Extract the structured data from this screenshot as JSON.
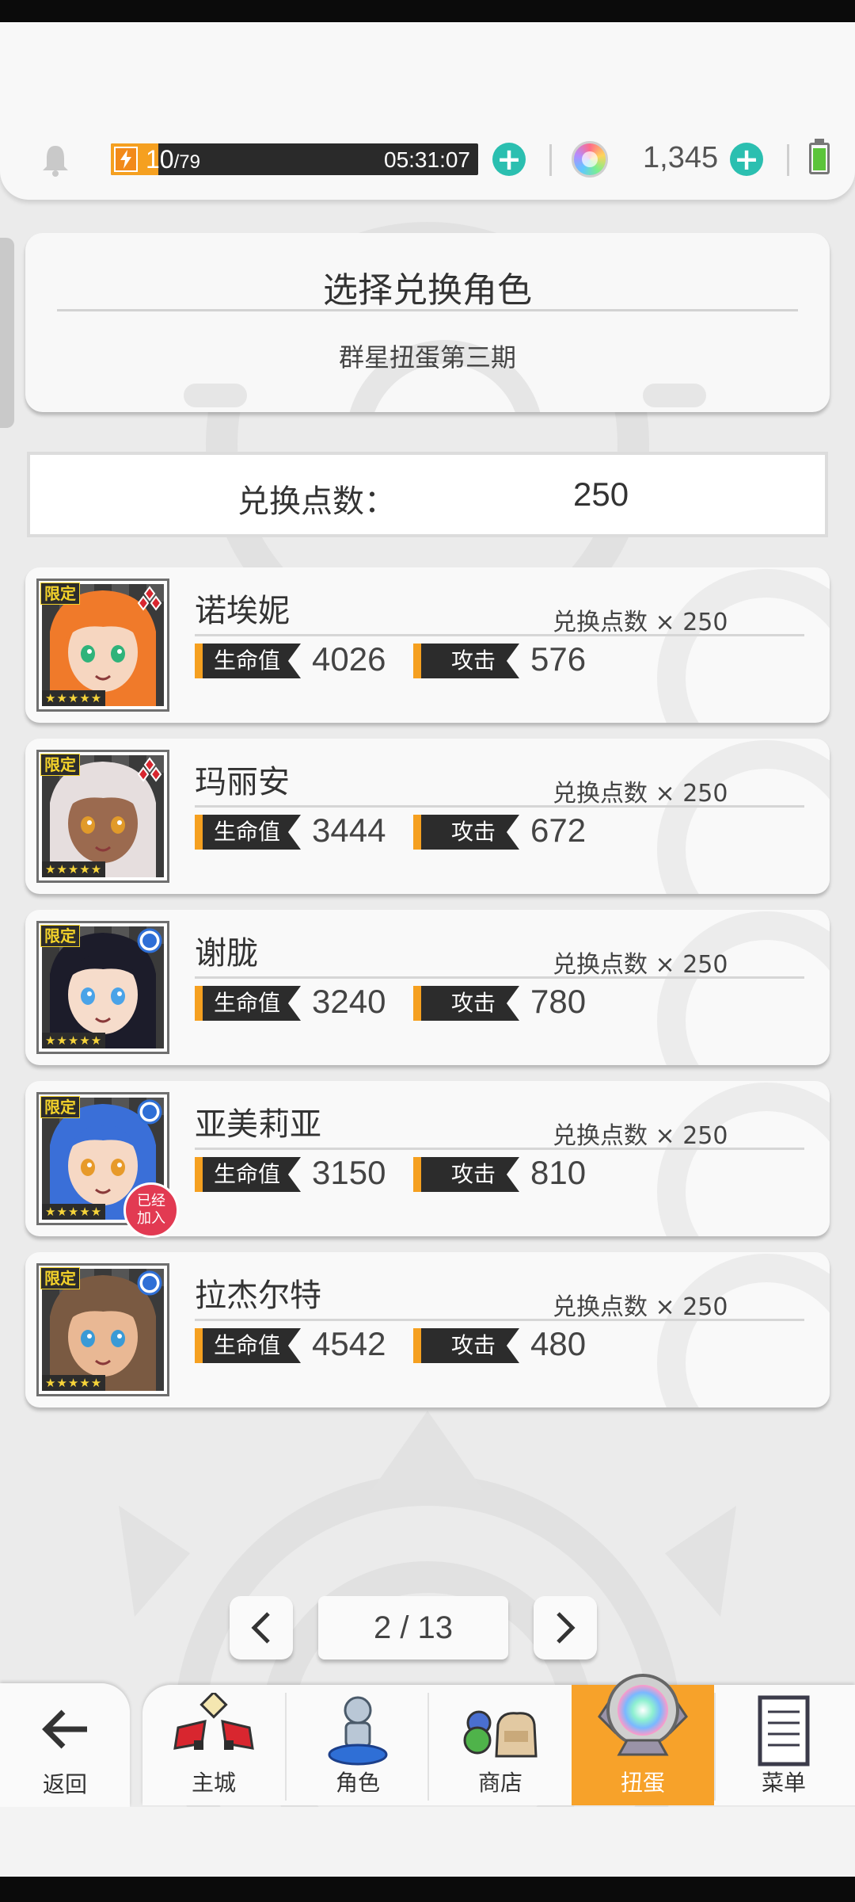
{
  "resources": {
    "stamina_current": "10",
    "stamina_max": "/79",
    "stamina_fill": 0.13,
    "timer": "05:31:07",
    "gems": "1,345"
  },
  "header": {
    "title": "选择兑换角色",
    "subtitle": "群星扭蛋第三期"
  },
  "points": {
    "label": "兑换点数：",
    "value": "250"
  },
  "labels": {
    "limited": "限定",
    "hp": "生命值",
    "atk": "攻击",
    "cost": "兑换点数 × 250",
    "stars": "★★★★★",
    "joined_line1": "已经",
    "joined_line2": "加入"
  },
  "characters": [
    {
      "name": "诺埃妮",
      "hp": "4026",
      "atk": "576",
      "element": "fire-diamonds",
      "hair": "#f07a2a",
      "skin": "#f6d6c0",
      "eyes": "#2fb37a"
    },
    {
      "name": "玛丽安",
      "hp": "3444",
      "atk": "672",
      "element": "fire-diamonds",
      "hair": "#e6dede",
      "skin": "#9b6a4f",
      "eyes": "#e19a2a"
    },
    {
      "name": "谢胧",
      "hp": "3240",
      "atk": "780",
      "element": "water-circle",
      "hair": "#1c1c2a",
      "skin": "#f6dccb",
      "eyes": "#4aa3e8"
    },
    {
      "name": "亚美莉亚",
      "hp": "3150",
      "atk": "810",
      "element": "water-circle",
      "hair": "#3a6fd8",
      "skin": "#f6d8c4",
      "eyes": "#e79a2a"
    },
    {
      "name": "拉杰尔特",
      "hp": "4542",
      "atk": "480",
      "element": "water-circle",
      "hair": "#7a5a42",
      "skin": "#e9b894",
      "eyes": "#3a9ad6"
    }
  ],
  "pagination": {
    "current": "2",
    "total": "13",
    "display": "2 / 13"
  },
  "nav": {
    "back": "返回",
    "main_city": "主城",
    "character": "角色",
    "shop": "商店",
    "gacha": "扭蛋",
    "menu": "菜单"
  },
  "colors": {
    "accent_orange": "#f7a22a",
    "teal_plus": "#2bbfb0",
    "joined_red": "#e23a52"
  }
}
